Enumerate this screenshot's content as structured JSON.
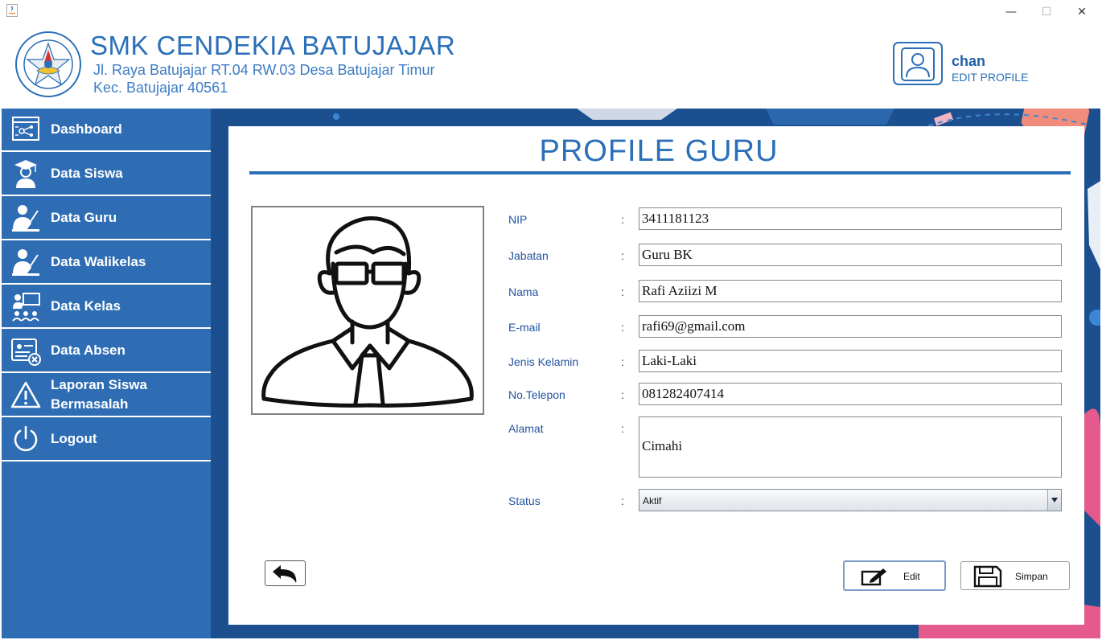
{
  "window": {
    "minimize": "—",
    "maximize": "☐",
    "close": "✕"
  },
  "header": {
    "school_name": "SMK CENDEKIA BATUJAJAR",
    "address_line1": "Jl. Raya Batujajar RT.04 RW.03 Desa Batujajar Timur",
    "address_line2": "Kec. Batujajar 40561",
    "logo_text_top": "SMK CENDEKIA BATUJAJAR",
    "logo_text_bottom": "YAYASAN PUTRA CENDEKIA",
    "user_name": "chan",
    "edit_profile_label": "EDIT PROFILE"
  },
  "sidebar": {
    "items": [
      {
        "label": "Dashboard",
        "icon": "dashboard-icon"
      },
      {
        "label": "Data Siswa",
        "icon": "student-icon"
      },
      {
        "label": "Data Guru",
        "icon": "teacher-icon"
      },
      {
        "label": "Data Walikelas",
        "icon": "homeroom-teacher-icon"
      },
      {
        "label": "Data Kelas",
        "icon": "classroom-icon"
      },
      {
        "label": "Data Absen",
        "icon": "attendance-icon"
      },
      {
        "label": "Laporan Siswa\nBermasalah",
        "icon": "warning-icon"
      },
      {
        "label": "Logout",
        "icon": "power-icon"
      }
    ]
  },
  "main": {
    "title": "PROFILE GURU",
    "colon": ":",
    "fields": {
      "nip": {
        "label": "NIP",
        "value": "3411181123"
      },
      "jabatan": {
        "label": "Jabatan",
        "value": "Guru BK"
      },
      "nama": {
        "label": "Nama",
        "value": "Rafi Aziizi M"
      },
      "email": {
        "label": "E-mail",
        "value": "rafi69@gmail.com"
      },
      "jenis_kelamin": {
        "label": "Jenis Kelamin",
        "value": "Laki-Laki"
      },
      "telepon": {
        "label": "No.Telepon",
        "value": "081282407414"
      },
      "alamat": {
        "label": "Alamat",
        "value": "Cimahi"
      },
      "status": {
        "label": "Status",
        "value": "Aktif"
      }
    },
    "buttons": {
      "edit": "Edit",
      "simpan": "Simpan"
    }
  },
  "colors": {
    "accent": "#2a6fb8",
    "sidebar": "#2e6db4",
    "background": "#1c4f8f"
  }
}
